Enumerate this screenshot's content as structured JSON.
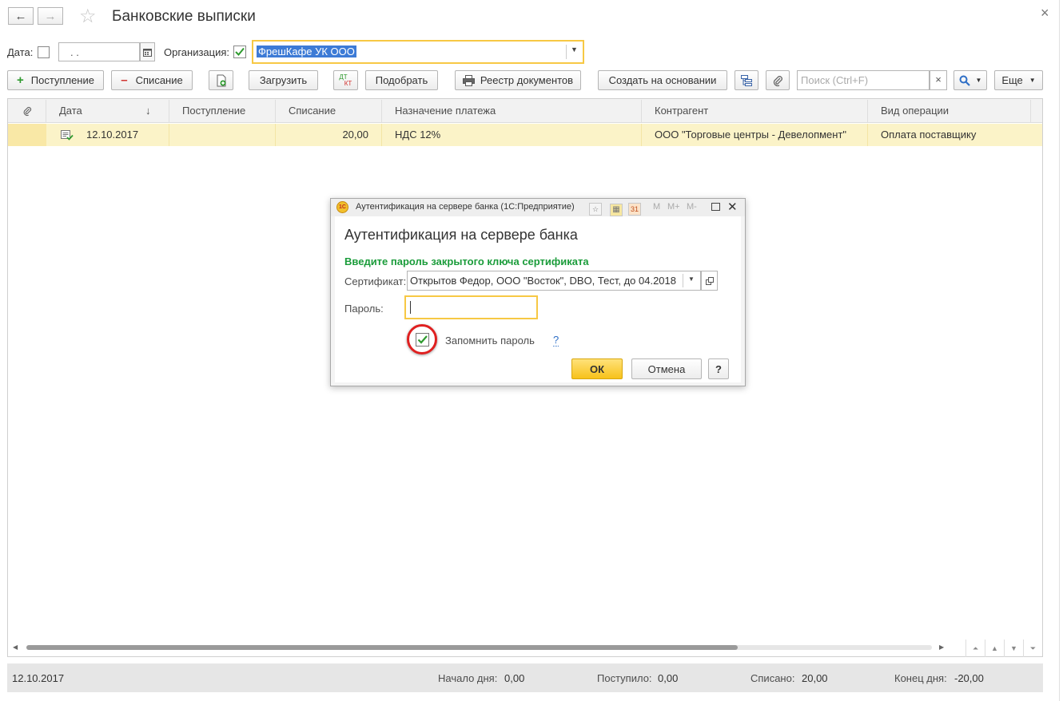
{
  "window": {
    "title": "Банковские выписки",
    "nav_back": "←",
    "nav_forward": "→",
    "star": "☆",
    "close": "×"
  },
  "filters": {
    "date_label": "Дата:",
    "date_value": " .  .",
    "org_label": "Организация:",
    "org_value": "ФрешКафе УК ООО"
  },
  "toolbar": {
    "receipt_label": "Поступление",
    "writeoff_label": "Списание",
    "load_label": "Загрузить",
    "dtkt_top": "ДТ",
    "dtkt_bottom": "КТ",
    "select_label": "Подобрать",
    "registry_label": "Реестр документов",
    "create_based_label": "Создать на основании",
    "search_placeholder": "Поиск (Ctrl+F)",
    "search_clear": "×",
    "more_label": "Еще"
  },
  "table": {
    "columns": [
      "Дата",
      "Поступление",
      "Списание",
      "Назначение платежа",
      "Контрагент",
      "Вид операции"
    ],
    "sort_arrow": "↓",
    "rows": [
      {
        "date": "12.10.2017",
        "receipt": "",
        "writeoff": "20,00",
        "purpose": "НДС 12%",
        "counterparty": "ООО \"Торговые центры - Девелопмент\"",
        "operation": "Оплата поставщику"
      }
    ]
  },
  "footer": {
    "date": "12.10.2017",
    "start_label": "Начало дня:",
    "start_value": "0,00",
    "received_label": "Поступило:",
    "received_value": "0,00",
    "spent_label": "Списано:",
    "spent_value": "20,00",
    "end_label": "Конец дня:",
    "end_value": "-20,00"
  },
  "dialog": {
    "window_title": "Аутентификация на сервере банка  (1С:Предприятие)",
    "heading": "Аутентификация на сервере банка",
    "prompt": "Введите пароль закрытого ключа сертификата",
    "cert_label": "Сертификат:",
    "cert_value": "Открытов Федор, ООО \"Восток\", DBO, Тест, до 04.2018",
    "password_label": "Пароль:",
    "password_value": "",
    "remember_label": "Запомнить пароль",
    "remember_checked": true,
    "help_link": "?",
    "ok_label": "ОК",
    "cancel_label": "Отмена",
    "help_button": "?",
    "title_m": "M",
    "title_mplus": "M+",
    "title_mminus": "M-",
    "calendar_day": "31"
  },
  "colors": {
    "accent_yellow": "#f7c844",
    "selected_row": "#fbf3c8",
    "prompt_green": "#1a9c3a",
    "checkbox_green": "#2e9a2e",
    "highlight_red": "#e02020"
  }
}
